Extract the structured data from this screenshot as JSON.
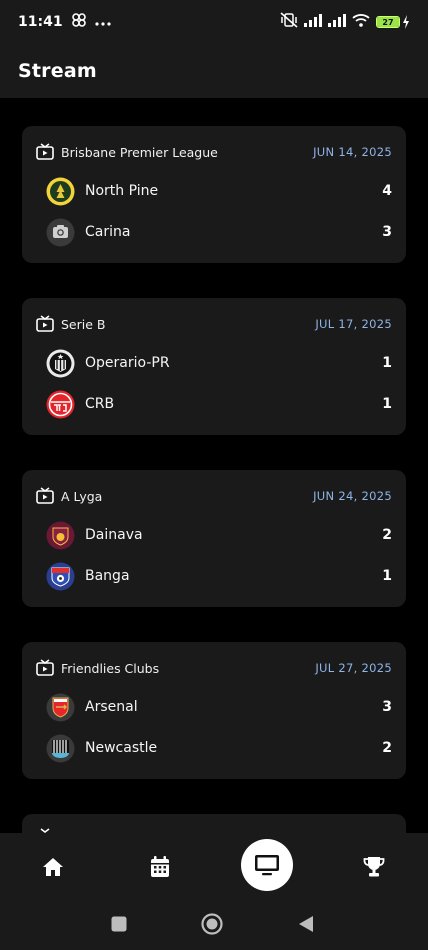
{
  "status_bar": {
    "time": "11:41",
    "battery_level": "27"
  },
  "app_bar": {
    "title": "Stream"
  },
  "matches": [
    {
      "league": "Brisbane Premier League",
      "date": "JUN 14, 2025",
      "home": {
        "name": "North Pine",
        "score": "4"
      },
      "away": {
        "name": "Carina",
        "score": "3"
      }
    },
    {
      "league": "Serie B",
      "date": "JUL 17, 2025",
      "home": {
        "name": "Operario-PR",
        "score": "1"
      },
      "away": {
        "name": "CRB",
        "score": "1"
      }
    },
    {
      "league": "A Lyga",
      "date": "JUN 24, 2025",
      "home": {
        "name": "Dainava",
        "score": "2"
      },
      "away": {
        "name": "Banga",
        "score": "1"
      }
    },
    {
      "league": "Friendlies Clubs",
      "date": "JUL 27, 2025",
      "home": {
        "name": "Arsenal",
        "score": "3"
      },
      "away": {
        "name": "Newcastle",
        "score": "2"
      }
    }
  ],
  "bottom_nav": {
    "items": [
      {
        "icon": "home-icon"
      },
      {
        "icon": "calendar-icon"
      },
      {
        "icon": "tv-icon",
        "active": true
      },
      {
        "icon": "trophy-icon"
      }
    ]
  },
  "colors": {
    "background": "#000000",
    "surface": "#1a1a1a",
    "date_accent": "#8fb4e6",
    "battery": "#9be34a"
  }
}
